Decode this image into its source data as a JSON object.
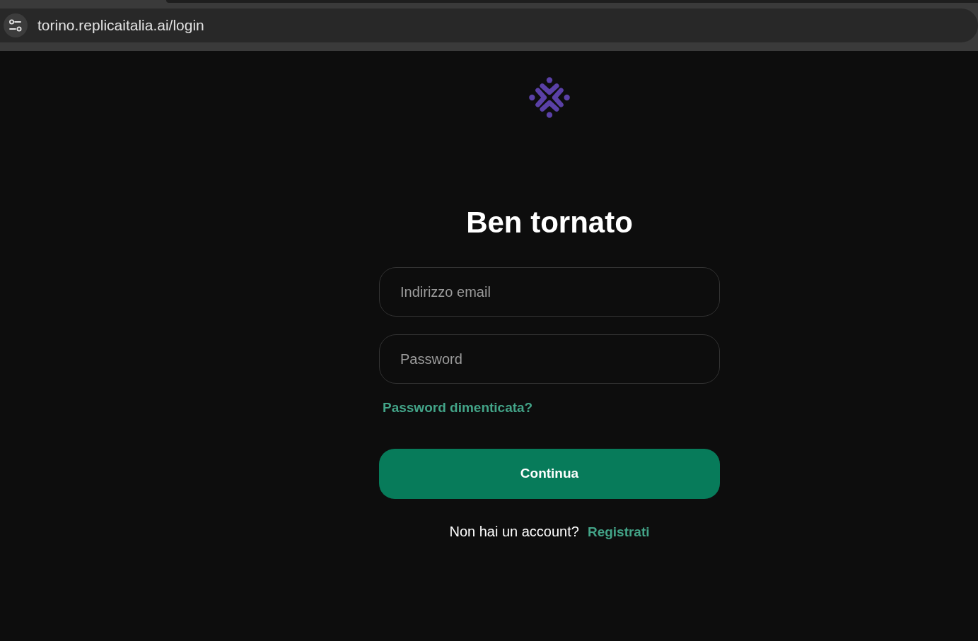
{
  "browser": {
    "url": "torino.replicaitalia.ai/login"
  },
  "heading": "Ben tornato",
  "email_field": {
    "placeholder": "Indirizzo email"
  },
  "password_field": {
    "placeholder": "Password"
  },
  "forgot_link": "Password dimenticata?",
  "submit_button": "Continua",
  "signup": {
    "prompt": "Non hai un account?",
    "link": "Registrati"
  }
}
